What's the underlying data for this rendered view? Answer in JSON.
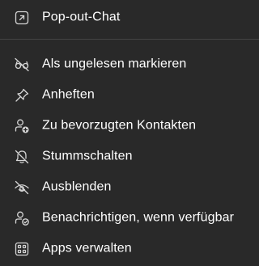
{
  "menu": {
    "items": [
      {
        "label": "Pop-out-Chat",
        "icon": "pop-out-icon"
      },
      {
        "label": "Als ungelesen markieren",
        "icon": "glasses-icon"
      },
      {
        "label": "Anheften",
        "icon": "pin-icon"
      },
      {
        "label": "Zu bevorzugten Kontakten",
        "icon": "person-add-icon"
      },
      {
        "label": "Stummschalten",
        "icon": "bell-off-icon"
      },
      {
        "label": "Ausblenden",
        "icon": "eye-off-icon"
      },
      {
        "label": "Benachrichtigen, wenn verfügbar",
        "icon": "person-available-icon"
      },
      {
        "label": "Apps verwalten",
        "icon": "apps-icon"
      }
    ]
  },
  "colors": {
    "background": "#292929",
    "text": "#ffffff",
    "icon": "#d6d6d6",
    "divider": "#454545"
  }
}
